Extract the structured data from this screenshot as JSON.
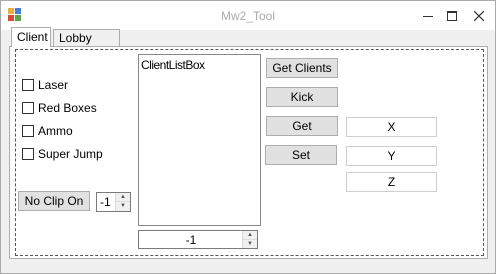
{
  "window": {
    "title": "Mw2_Tool",
    "controls": {
      "minimize": "minimize-icon",
      "maximize": "maximize-icon",
      "close": "close-icon"
    }
  },
  "tabs": [
    {
      "label": "Client",
      "selected": true
    },
    {
      "label": "Lobby Mods",
      "selected": false
    }
  ],
  "checkboxes": [
    {
      "label": "Laser",
      "checked": false
    },
    {
      "label": "Red Boxes",
      "checked": false
    },
    {
      "label": "Ammo",
      "checked": false
    },
    {
      "label": "Super Jump",
      "checked": false
    }
  ],
  "no_clip_button": "No Clip On",
  "no_clip_spinner": "-1",
  "client_list": {
    "label": "ClientListBox"
  },
  "client_spinner": "-1",
  "buttons": {
    "get_clients": "Get Clients",
    "kick": "Kick",
    "get": "Get",
    "set": "Set"
  },
  "coords": {
    "x": "X",
    "y": "Y",
    "z": "Z"
  },
  "colors": {
    "focus_border": "#0078d7",
    "button_face": "#e1e1e1",
    "window_bg": "#f0f0f0"
  }
}
